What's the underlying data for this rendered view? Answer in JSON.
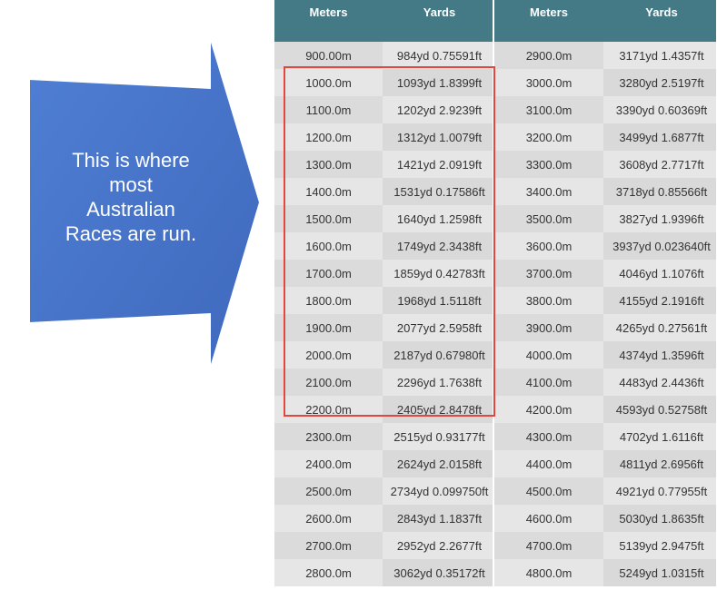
{
  "callout": {
    "lines": [
      "This is where",
      "most",
      "Australian",
      "Races are run."
    ],
    "color": "#4a77cc"
  },
  "table": {
    "headers": [
      "Meters",
      "Yards",
      "Meters",
      "Yards"
    ],
    "rows": [
      [
        "900.00m",
        "984yd 0.75591ft",
        "2900.0m",
        "3171yd 1.4357ft"
      ],
      [
        "1000.0m",
        "1093yd 1.8399ft",
        "3000.0m",
        "3280yd 2.5197ft"
      ],
      [
        "1100.0m",
        "1202yd 2.9239ft",
        "3100.0m",
        "3390yd 0.60369ft"
      ],
      [
        "1200.0m",
        "1312yd 1.0079ft",
        "3200.0m",
        "3499yd 1.6877ft"
      ],
      [
        "1300.0m",
        "1421yd 2.0919ft",
        "3300.0m",
        "3608yd 2.7717ft"
      ],
      [
        "1400.0m",
        "1531yd 0.17586ft",
        "3400.0m",
        "3718yd 0.85566ft"
      ],
      [
        "1500.0m",
        "1640yd 1.2598ft",
        "3500.0m",
        "3827yd 1.9396ft"
      ],
      [
        "1600.0m",
        "1749yd 2.3438ft",
        "3600.0m",
        "3937yd 0.023640ft"
      ],
      [
        "1700.0m",
        "1859yd 0.42783ft",
        "3700.0m",
        "4046yd 1.1076ft"
      ],
      [
        "1800.0m",
        "1968yd 1.5118ft",
        "3800.0m",
        "4155yd 2.1916ft"
      ],
      [
        "1900.0m",
        "2077yd 2.5958ft",
        "3900.0m",
        "4265yd 0.27561ft"
      ],
      [
        "2000.0m",
        "2187yd 0.67980ft",
        "4000.0m",
        "4374yd 1.3596ft"
      ],
      [
        "2100.0m",
        "2296yd 1.7638ft",
        "4100.0m",
        "4483yd 2.4436ft"
      ],
      [
        "2200.0m",
        "2405yd 2.8478ft",
        "4200.0m",
        "4593yd 0.52758ft"
      ],
      [
        "2300.0m",
        "2515yd 0.93177ft",
        "4300.0m",
        "4702yd 1.6116ft"
      ],
      [
        "2400.0m",
        "2624yd 2.0158ft",
        "4400.0m",
        "4811yd 2.6956ft"
      ],
      [
        "2500.0m",
        "2734yd 0.099750ft",
        "4500.0m",
        "4921yd 0.77955ft"
      ],
      [
        "2600.0m",
        "2843yd 1.1837ft",
        "4600.0m",
        "5030yd 1.8635ft"
      ],
      [
        "2700.0m",
        "2952yd 2.2677ft",
        "4700.0m",
        "5139yd 2.9475ft"
      ],
      [
        "2800.0m",
        "3062yd 0.35172ft",
        "4800.0m",
        "5249yd 1.0315ft"
      ]
    ]
  },
  "colors": {
    "header_bg": "#447a86",
    "highlight_border": "#e2463f"
  }
}
